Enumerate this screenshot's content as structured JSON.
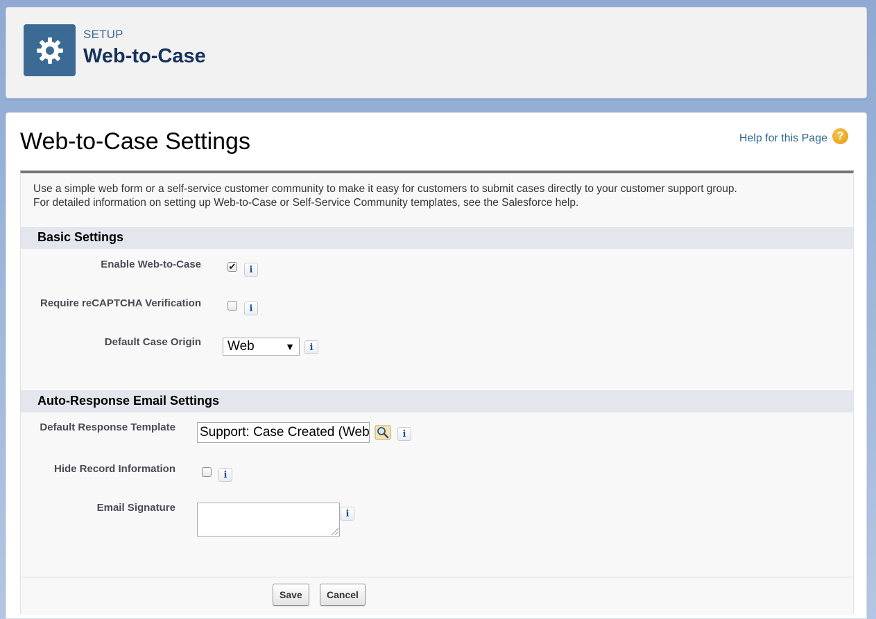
{
  "header": {
    "setup_label": "SETUP",
    "title": "Web-to-Case",
    "icon": "gear-icon",
    "icon_bg": "#3b6b94"
  },
  "page": {
    "title": "Web-to-Case Settings",
    "help_link": "Help for this Page",
    "help_icon": "?",
    "description_line1": "Use a simple web form or a self-service customer community to make it easy for customers to submit cases directly to your customer support group.",
    "description_line2": "For detailed information on setting up Web-to-Case or Self-Service Community templates, see the Salesforce help."
  },
  "basic_settings": {
    "heading": "Basic Settings",
    "enable_web_to_case": {
      "label": "Enable Web-to-Case",
      "checked": true,
      "check_glyph": "✔"
    },
    "require_recaptcha": {
      "label": "Require reCAPTCHA Verification",
      "checked": false
    },
    "default_case_origin": {
      "label": "Default Case Origin",
      "value": "Web",
      "arrow": "▼"
    }
  },
  "auto_response": {
    "heading": "Auto-Response Email Settings",
    "default_response_template": {
      "label": "Default Response Template",
      "value": "Support: Case Created (Web"
    },
    "hide_record_information": {
      "label": "Hide Record Information",
      "checked": false
    },
    "email_signature": {
      "label": "Email Signature",
      "value": ""
    }
  },
  "info_glyph": "i",
  "buttons": {
    "save": "Save",
    "cancel": "Cancel"
  }
}
